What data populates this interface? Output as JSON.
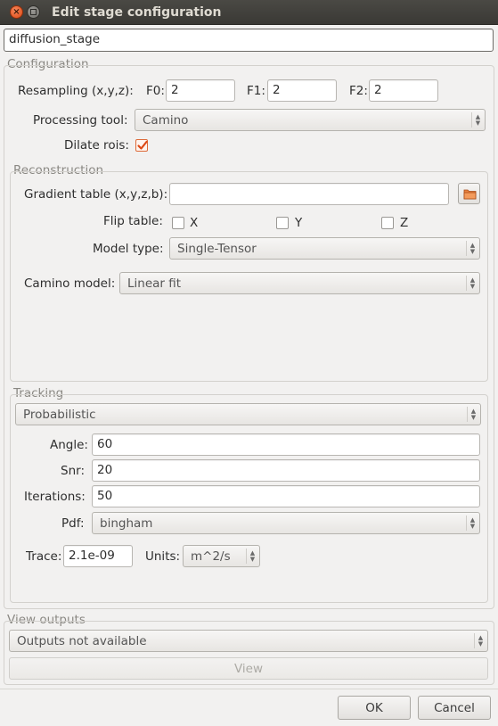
{
  "window": {
    "title": "Edit stage configuration"
  },
  "stage_name": "diffusion_stage",
  "configuration": {
    "title": "Configuration",
    "resampling_label": "Resampling (x,y,z):",
    "f0_label": "F0:",
    "f0_value": "2",
    "f1_label": "F1:",
    "f1_value": "2",
    "f2_label": "F2:",
    "f2_value": "2",
    "processing_tool_label": "Processing tool:",
    "processing_tool_value": "Camino",
    "dilate_rois_label": "Dilate rois:",
    "dilate_rois_checked": true
  },
  "reconstruction": {
    "title": "Reconstruction",
    "gradient_table_label": "Gradient table (x,y,z,b):",
    "gradient_table_value": "",
    "flip_table_label": "Flip table:",
    "flip_x_label": "X",
    "flip_y_label": "Y",
    "flip_z_label": "Z",
    "model_type_label": "Model type:",
    "model_type_value": "Single-Tensor",
    "camino_model_label": "Camino model:",
    "camino_model_value": "Linear fit"
  },
  "tracking": {
    "title": "Tracking",
    "method_value": "Probabilistic",
    "angle_label": "Angle:",
    "angle_value": "60",
    "snr_label": "Snr:",
    "snr_value": "20",
    "iterations_label": "Iterations:",
    "iterations_value": "50",
    "pdf_label": "Pdf:",
    "pdf_value": "bingham",
    "trace_label": "Trace:",
    "trace_value": "2.1e-09",
    "units_label": "Units:",
    "units_value": "m^2/s"
  },
  "view_outputs": {
    "title": "View outputs",
    "outputs_value": "Outputs not available",
    "view_label": "View"
  },
  "footer": {
    "ok_label": "OK",
    "cancel_label": "Cancel"
  },
  "colors": {
    "accent": "#dd4814",
    "background": "#f2f1f0",
    "titlebar": "#3c3b37"
  },
  "icons": {
    "close": "close-icon",
    "minimize": "minimize-icon",
    "folder": "folder-icon",
    "combo_arrows": "updown-arrows-icon",
    "check": "checkmark-icon"
  }
}
